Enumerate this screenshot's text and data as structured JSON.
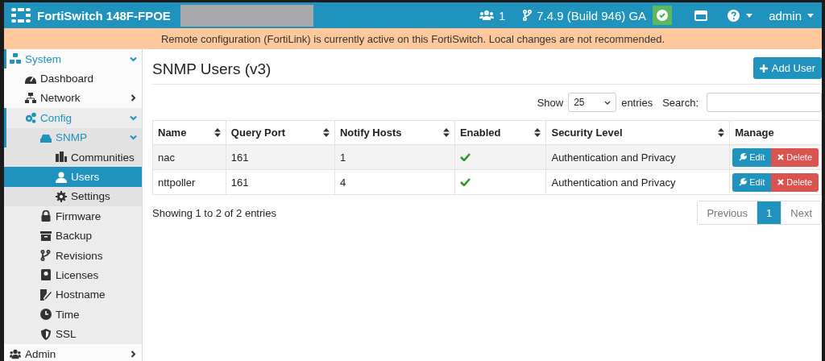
{
  "header": {
    "product": "FortiSwitch 148F-FPOE",
    "users_count": "1",
    "version": "7.4.9 (Build 946) GA",
    "user": "admin"
  },
  "banner": "Remote configuration (FortiLink) is currently active on this FortiSwitch. Local changes are not recommended.",
  "sidebar": {
    "items": [
      {
        "label": "System",
        "expanded": true,
        "selected": false,
        "children": [
          {
            "label": "Dashboard",
            "selected": false
          },
          {
            "label": "Network",
            "expanded": false,
            "selected": false
          },
          {
            "label": "Config",
            "expanded": true,
            "selected": false,
            "children": [
              {
                "label": "SNMP",
                "expanded": true,
                "selected": false,
                "children": [
                  {
                    "label": "Communities",
                    "selected": false
                  },
                  {
                    "label": "Users",
                    "selected": true
                  },
                  {
                    "label": "Settings",
                    "selected": false
                  }
                ]
              },
              {
                "label": "Firmware",
                "selected": false
              },
              {
                "label": "Backup",
                "selected": false
              },
              {
                "label": "Revisions",
                "selected": false
              },
              {
                "label": "Licenses",
                "selected": false
              },
              {
                "label": "Hostname",
                "selected": false
              },
              {
                "label": "Time",
                "selected": false
              },
              {
                "label": "SSL",
                "selected": false
              }
            ]
          }
        ]
      },
      {
        "label": "Admin",
        "expanded": false,
        "selected": false
      }
    ]
  },
  "page": {
    "title": "SNMP Users (v3)",
    "add_button": "Add User",
    "show_label": "Show",
    "page_size": "25",
    "entries_label": "entries",
    "search_label": "Search:"
  },
  "table": {
    "columns": [
      "Name",
      "Query Port",
      "Notify Hosts",
      "Enabled",
      "Security Level",
      "Manage"
    ],
    "rows": [
      {
        "name": "nac",
        "query_port": "161",
        "notify_hosts": "1",
        "enabled": true,
        "security_level": "Authentication and Privacy",
        "edit": "Edit",
        "delete": "Delete"
      },
      {
        "name": "nttpoller",
        "query_port": "161",
        "notify_hosts": "4",
        "enabled": true,
        "security_level": "Authentication and Privacy",
        "edit": "Edit",
        "delete": "Delete"
      }
    ]
  },
  "footer": {
    "info": "Showing 1 to 2 of 2 entries",
    "pagination": [
      {
        "label": "Previous",
        "selected": false
      },
      {
        "label": "1",
        "selected": true
      },
      {
        "label": "Next",
        "selected": false
      }
    ]
  }
}
